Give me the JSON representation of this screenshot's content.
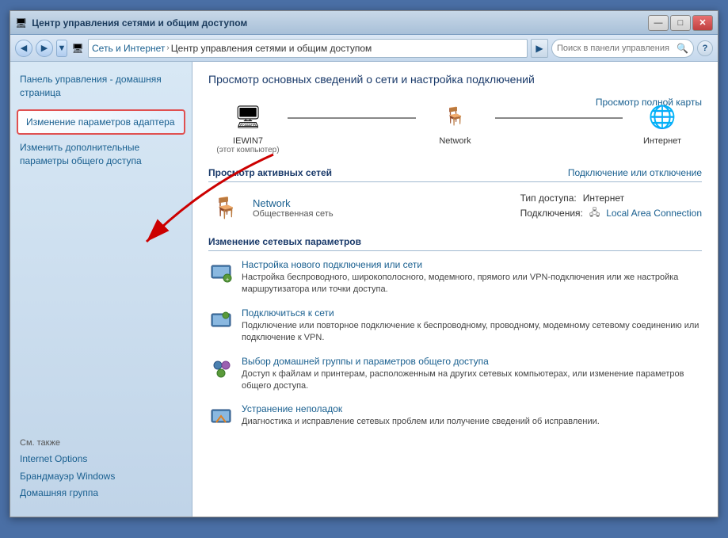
{
  "window": {
    "title": "Центр управления сетями и общим доступом",
    "controls": {
      "minimize": "—",
      "maximize": "□",
      "close": "✕"
    }
  },
  "addressbar": {
    "back_tooltip": "Назад",
    "forward_tooltip": "Вперёд",
    "recent_tooltip": "Последние",
    "breadcrumb": {
      "root_icon": "🖥",
      "part1": "Сеть и Интернет",
      "part2": "Центр управления сетями и общим доступом"
    },
    "search_placeholder": "Поиск в панели управления",
    "help_label": "?"
  },
  "sidebar": {
    "home_label": "Панель управления - домашняя страница",
    "highlighted_link": "Изменение параметров адаптера",
    "change_advanced": "Изменить дополнительные параметры общего доступа",
    "also_title": "См. также",
    "also_links": [
      "Internet Options",
      "Брандмауэр Windows",
      "Домашняя группа"
    ]
  },
  "content": {
    "title": "Просмотр основных сведений о сети и настройка подключений",
    "view_map_link": "Просмотр полной карты",
    "network_map": {
      "nodes": [
        {
          "icon": "🖥",
          "label": "IEWIN7",
          "sublabel": "(этот компьютер)"
        },
        {
          "icon": "🪑",
          "label": "Network",
          "sublabel": ""
        },
        {
          "icon": "🌐",
          "label": "Интернет",
          "sublabel": ""
        }
      ]
    },
    "active_networks_title": "Просмотр активных сетей",
    "connect_disconnect": "Подключение или отключение",
    "active_network": {
      "name": "Network",
      "type": "Общественная сеть",
      "access_type_label": "Тип доступа:",
      "access_type_value": "Интернет",
      "connections_label": "Подключения:",
      "connections_value": "Local Area Connection"
    },
    "change_settings_title": "Изменение сетевых параметров",
    "settings": [
      {
        "icon": "⚙",
        "title": "Настройка нового подключения или сети",
        "desc": "Настройка беспроводного, широкополосного, модемного, прямого или VPN-подключения или же настройка маршрутизатора или точки доступа."
      },
      {
        "icon": "⚙",
        "title": "Подключиться к сети",
        "desc": "Подключение или повторное подключение к беспроводному, проводному, модемному сетевому соединению или подключение к VPN."
      },
      {
        "icon": "⚙",
        "title": "Выбор домашней группы и параметров общего доступа",
        "desc": "Доступ к файлам и принтерам, расположенным на других сетевых компьютерах, или изменение параметров общего доступа."
      },
      {
        "icon": "⚙",
        "title": "Устранение неполадок",
        "desc": "Диагностика и исправление сетевых проблем или получение сведений об исправлении."
      }
    ]
  }
}
